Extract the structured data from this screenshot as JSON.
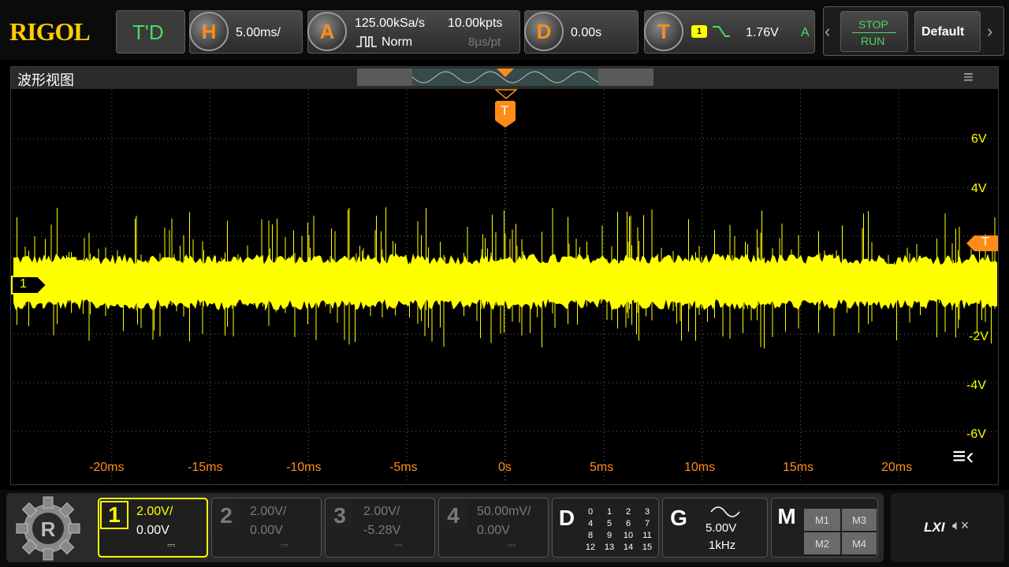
{
  "brand": {
    "logo": "RIGOL"
  },
  "top": {
    "td_label": "T'D",
    "horizontal": {
      "key": "H",
      "value": "5.00ms/"
    },
    "acquire": {
      "key": "A",
      "sample_rate": "125.00kSa/s",
      "mode": "Norm",
      "points": "10.00kpts",
      "resolution": "8μs/pt"
    },
    "delay": {
      "key": "D",
      "value": "0.00s"
    },
    "trigger": {
      "key": "T",
      "source": "1",
      "level": "1.76V",
      "status": "A"
    },
    "stop_run": {
      "stop": "STOP",
      "run": "RUN"
    },
    "default_btn": "Default"
  },
  "wave": {
    "title": "波形视图",
    "trigger_marker": "T",
    "right_trigger_marker": "T",
    "channel_marker": "1",
    "y_labels": [
      "6V",
      "4V",
      "-2V",
      "-4V",
      "-6V"
    ],
    "x_labels": [
      "-20ms",
      "-15ms",
      "-10ms",
      "-5ms",
      "0s",
      "5ms",
      "10ms",
      "15ms",
      "20ms"
    ]
  },
  "channels": [
    {
      "num": "1",
      "scale": "2.00V/",
      "offset": "0.00V",
      "active": true,
      "color": "#ffff00"
    },
    {
      "num": "2",
      "scale": "2.00V/",
      "offset": "0.00V",
      "active": false,
      "color": "#7a7a7a"
    },
    {
      "num": "3",
      "scale": "2.00V/",
      "offset": "-5.28V",
      "active": false,
      "color": "#7a7a7a"
    },
    {
      "num": "4",
      "scale": "50.00mV/",
      "offset": "0.00V",
      "active": false,
      "color": "#7a7a7a"
    }
  ],
  "digital": {
    "key": "D",
    "grid": [
      "0",
      "1",
      "2",
      "3",
      "4",
      "5",
      "6",
      "7",
      "8",
      "9",
      "10",
      "11",
      "12",
      "13",
      "14",
      "15"
    ]
  },
  "generator": {
    "key": "G",
    "amplitude": "5.00V",
    "frequency": "1kHz"
  },
  "math": {
    "key": "M",
    "buttons": [
      "M1",
      "M3",
      "M2",
      "M4"
    ]
  },
  "status": {
    "lxi": "LXI"
  },
  "colors": {
    "ch1": "#ffff00",
    "trigger": "#ff8c1a",
    "accent_green": "#4cd964"
  }
}
